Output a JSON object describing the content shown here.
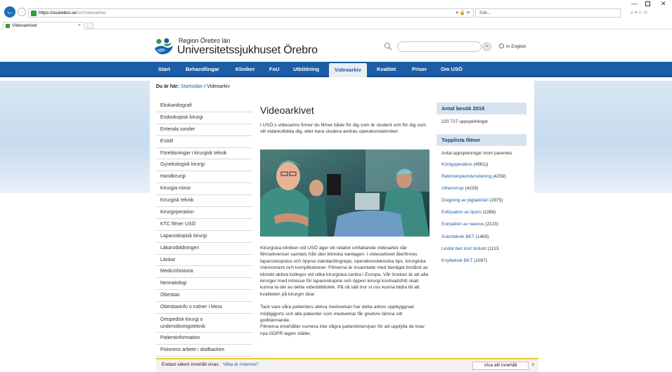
{
  "browser": {
    "url_host": "https://usorebro.se",
    "url_path": "/sv/Videoarkiv/",
    "address_icons": "▾ 🔒 ⟳",
    "search_placeholder": "Sök...",
    "tab_title": "Videoarkivet",
    "tab_close": "×",
    "minimize": "—",
    "close": "✕",
    "right_icons": "⌕ ▾   ⌂ ☆"
  },
  "header": {
    "logo_line1": "Region Örebro län",
    "logo_line2": "Universitetssjukhuset Örebro",
    "search_button": "»",
    "language_link": "In English",
    "brand_color": "#1c5da8"
  },
  "nav": {
    "items": [
      "Start",
      "Behandlingar",
      "Kliniker",
      "FoU",
      "Utbildning",
      "Videoarkiv",
      "Kvalitet",
      "Priser",
      "Om USÖ"
    ],
    "active": "Videoarkiv"
  },
  "breadcrumb": {
    "prefix": "Du är här:",
    "home": "Startsidan",
    "separator": " / ",
    "current": "Videoarkiv"
  },
  "left_menu": [
    "Ekokardiografi",
    "Endoskopisk kirurgi",
    "Enterala sonder",
    "EVAR",
    "Föreläsningar i kirurgisk teknik",
    "Gynekologisk kirurgi",
    "Handkirurgi",
    "Kirurgia minor",
    "Kirurgisk teknik",
    "Kirurgoperation",
    "KTC filmer USÖ",
    "Laparoskopisk kirurgi",
    "Läkarutbildningen",
    "Länkar",
    "Medicinhistoria",
    "Neonatologi",
    "Obesitas",
    "Obesitasinfo o rutiner i Mora",
    "Ortopedisk kirurgi o undersökningsteknik",
    "Patientinformation",
    "Pistorens arbete i skidbacken"
  ],
  "main": {
    "title": "Videoarkivet",
    "intro": "I USÖ:s videoarkiv finner du filmer både för dig som är student och för dig som vill vidareutbilda dig, eller bara studera andras operationstekniker.",
    "para1": "Kirurgiska kliniken vid USÖ äger ett relativt omfattande videoarkiv där filmsekvenser samlats från den kliniska vardagen. I videoarkivet återfinnes laparoskopiska och öppna standardingrepp, operationstekniska tips, kirurgiska riskmoment och komplikationer. Filmerna är insamlade med benäget bistånd av kliniskt aktiva kollegor vid olika kirurgiska centra i Europa. Vår önskan är att alla kirurger med intresse för laparoskopisk och öppen kirurgi kostnadsfritt skall kunna ta del av detta videobibliotek. På så sätt tror vi oss kunna bidra till att kvaliteten på kirurgin ökar.",
    "para2": "Tack vare våra patienters aktiva medverkan har detta arkivs uppbyggnad möjliggjorts och alla patienter som medverkar får givetvis lämna sitt godkännande.",
    "para3": "Filmerna innehåller numera inte några patientintervjuer för att uppfylla de krav nya GDPR lagen ställer."
  },
  "right": {
    "visits_title": "Antal besök 2018",
    "visits_value": "220 727  uppspelningar",
    "top_title": "Topplista filmer",
    "top_note": "Antal uppspelningar inom parentes",
    "top_list": [
      {
        "name": "Königoperation",
        "count": " (4561))"
      },
      {
        "name": "Rektoskopiundersökning",
        "count": " (4259)"
      },
      {
        "name": "Atheromop",
        "count": " (4239)"
      },
      {
        "name": "Dragning av pigtaildrän",
        "count": " (2975)"
      },
      {
        "name": "Extirpation av lipom",
        "count": " (2288)"
      },
      {
        "name": "Exirpation av naevus",
        "count": " (2123)"
      },
      {
        "name": "Suturteknik BKT",
        "count": " (1493)"
      },
      {
        "name": "Lindat ben kort sträckt",
        "count": "  (1113"
      },
      {
        "name": "Knytteknik BKT",
        "count": " (1097)"
      }
    ]
  },
  "notification": {
    "text": "Endast säkert innehåll visas.",
    "risk_link": "Vilka är riskerna?",
    "button": "Visa allt innehåll",
    "close": "×"
  }
}
